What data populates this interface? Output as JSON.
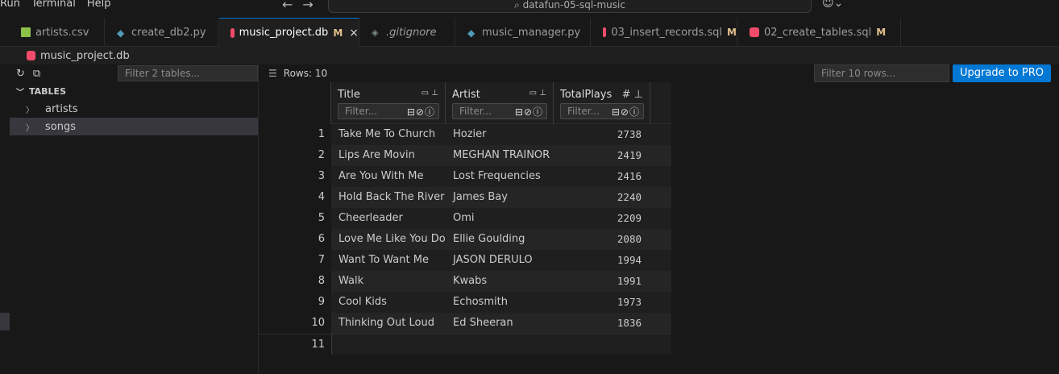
{
  "menu": [
    "Run",
    "Terminal",
    "Help"
  ],
  "command_center": {
    "text": "datafun-05-sql-music"
  },
  "tabs": [
    {
      "label": "artists.csv",
      "icon": "csv-icon"
    },
    {
      "label": "create_db2.py",
      "icon": "python-icon"
    },
    {
      "label": "music_project.db",
      "icon": "database-icon",
      "modified": "M",
      "close": "×"
    },
    {
      "label": ".gitignore",
      "icon": "git-icon"
    },
    {
      "label": "music_manager.py",
      "icon": "python-icon"
    },
    {
      "label": "03_insert_records.sql",
      "icon": "database-icon",
      "modified": "M"
    },
    {
      "label": "02_create_tables.sql",
      "icon": "database-icon",
      "modified": "M"
    }
  ],
  "breadcrumb": {
    "label": "music_project.db"
  },
  "sidebar": {
    "filter_placeholder": "Filter 2 tables...",
    "section_title": "TABLES",
    "items": [
      {
        "label": "artists"
      },
      {
        "label": "songs",
        "selected": true
      }
    ]
  },
  "main": {
    "rows_label": "Rows: 10",
    "filter_placeholder": "Filter 10 rows...",
    "upgrade_label": "Upgrade to PRO"
  },
  "grid": {
    "columns": [
      {
        "title": "Title",
        "filter_placeholder": "Filter..."
      },
      {
        "title": "Artist",
        "filter_placeholder": "Filter..."
      },
      {
        "title": "TotalPlays",
        "filter_placeholder": "Filter..."
      }
    ],
    "rows": [
      {
        "n": "1",
        "title": "Take Me To Church",
        "artist": "Hozier",
        "plays": "2738"
      },
      {
        "n": "2",
        "title": "Lips Are Movin",
        "artist": "MEGHAN TRAINOR",
        "plays": "2419"
      },
      {
        "n": "3",
        "title": "Are You With Me",
        "artist": "Lost Frequencies",
        "plays": "2416"
      },
      {
        "n": "4",
        "title": "Hold Back The River",
        "artist": "James Bay",
        "plays": "2240"
      },
      {
        "n": "5",
        "title": "Cheerleader",
        "artist": "Omi",
        "plays": "2209"
      },
      {
        "n": "6",
        "title": "Love Me Like You Do",
        "artist": "Ellie Goulding",
        "plays": "2080"
      },
      {
        "n": "7",
        "title": "Want To Want Me",
        "artist": "JASON DERULO",
        "plays": "1994"
      },
      {
        "n": "8",
        "title": "Walk",
        "artist": "Kwabs",
        "plays": "1991"
      },
      {
        "n": "9",
        "title": "Cool Kids",
        "artist": "Echosmith",
        "plays": "1973"
      },
      {
        "n": "10",
        "title": "Thinking Out Loud",
        "artist": "Ed Sheeran",
        "plays": "1836"
      }
    ],
    "new_row_index": "11"
  }
}
